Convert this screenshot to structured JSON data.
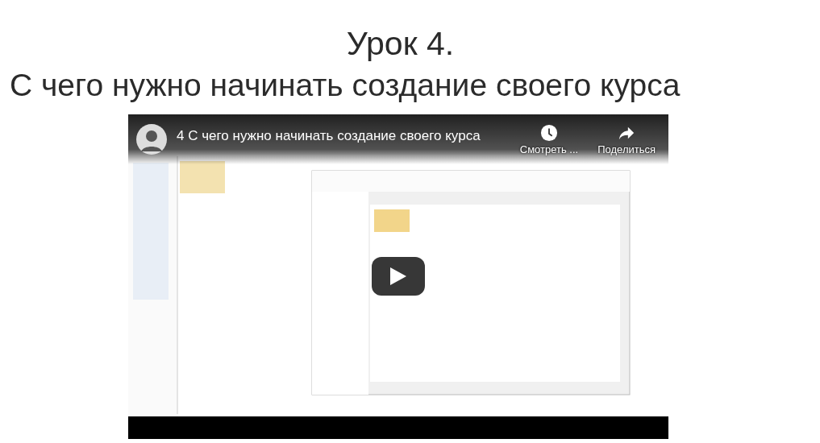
{
  "page": {
    "heading": "Урок 4.",
    "subheading": "С чего нужно начинать создание своего курса"
  },
  "video": {
    "kind": "picture",
    "title": "4 С чего нужно начинать создание своего курса",
    "actions": [
      {
        "label": "Смотреть ...",
        "kind": "watch_later"
      },
      {
        "label": "Поделиться",
        "kind": "share"
      }
    ]
  }
}
